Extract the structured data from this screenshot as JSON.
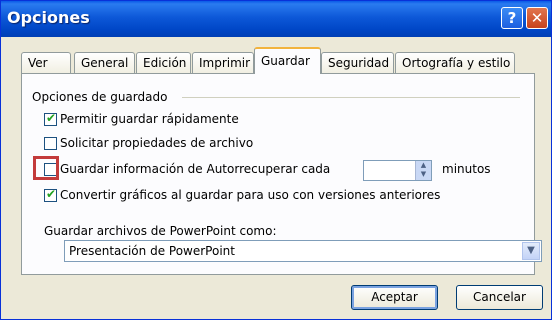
{
  "window": {
    "title": "Opciones",
    "help_label": "?",
    "close_label": "✕"
  },
  "tabs": [
    {
      "label": "Ver"
    },
    {
      "label": "General"
    },
    {
      "label": "Edición"
    },
    {
      "label": "Imprimir"
    },
    {
      "label": "Guardar"
    },
    {
      "label": "Seguridad"
    },
    {
      "label": "Ortografía y estilo"
    }
  ],
  "active_tab": "Guardar",
  "save_options": {
    "legend": "Opciones de guardado",
    "fast_save": {
      "label": "Permitir guardar rápidamente",
      "checked": true
    },
    "prompt_props": {
      "label": "Solicitar propiedades de archivo",
      "checked": false
    },
    "autorecover": {
      "label": "Guardar información de Autorrecuperar cada",
      "checked": false,
      "value": "",
      "unit": "minutos"
    },
    "convert_graphics": {
      "label": "Convertir gráficos al guardar para uso con versiones anteriores",
      "checked": true
    }
  },
  "save_as": {
    "label": "Guardar archivos de PowerPoint como:",
    "selected": "Presentación de PowerPoint"
  },
  "buttons": {
    "ok": "Aceptar",
    "cancel": "Cancelar"
  },
  "colors": {
    "title_bar": "#0046c6",
    "highlight": "#c33b3b",
    "active_tab_top": "#f2b33d"
  }
}
